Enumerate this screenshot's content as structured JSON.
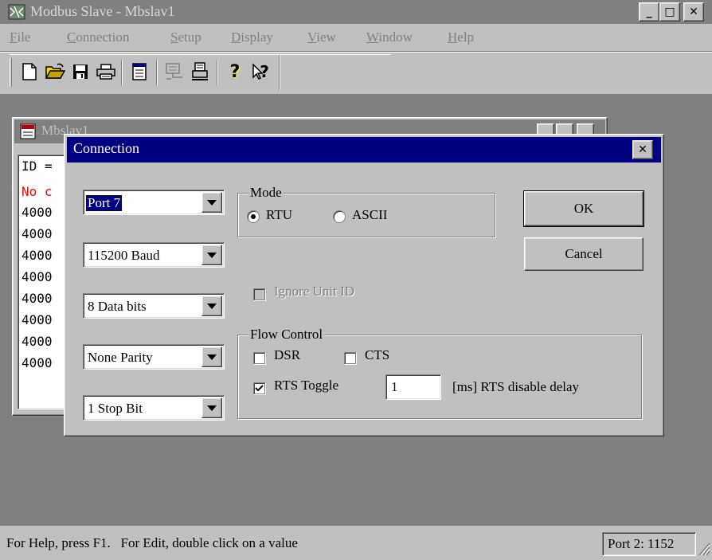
{
  "app": {
    "title": "Modbus Slave - Mbslav1",
    "controls": {
      "minimize": "_",
      "maximize": "□",
      "close": "✕"
    }
  },
  "menu": {
    "items": [
      {
        "label": "File",
        "accel": "F",
        "rest": "ile"
      },
      {
        "label": "Connection",
        "accel": "C",
        "rest": "onnection"
      },
      {
        "label": "Setup",
        "accel": "S",
        "rest": "etup"
      },
      {
        "label": "Display",
        "accel": "D",
        "rest": "isplay"
      },
      {
        "label": "View",
        "accel": "V",
        "rest": "iew"
      },
      {
        "label": "Window",
        "accel": "W",
        "rest": "indow"
      },
      {
        "label": "Help",
        "accel": "H",
        "rest": "elp"
      }
    ]
  },
  "toolbar": {
    "icons": [
      "new-icon",
      "open-icon",
      "save-icon",
      "print-icon",
      "window-icon",
      "connect-icon",
      "printer-setup-icon",
      "help-icon",
      "context-help-icon"
    ],
    "help_glyph": "?",
    "context_help_glyph": "?"
  },
  "child_window": {
    "title": "Mbslav1",
    "rows": [
      "ID =",
      "No c",
      "4000",
      "4000",
      "4000",
      "4000",
      "4000",
      "4000",
      "4000",
      "4000"
    ],
    "row_colors": [
      "#000000",
      "#ff0000",
      "#000000",
      "#000000",
      "#000000",
      "#000000",
      "#000000",
      "#000000",
      "#000000",
      "#000000"
    ]
  },
  "dialog": {
    "title": "Connection",
    "close_glyph": "✕",
    "port": "Port 7",
    "baud": "115200 Baud",
    "data_bits": "8 Data bits",
    "parity": "None Parity",
    "stop_bits": "1 Stop Bit",
    "mode": {
      "label": "Mode",
      "options": [
        "RTU",
        "ASCII"
      ],
      "selected": "RTU"
    },
    "ignore_unit_id": {
      "label": "Ignore Unit ID",
      "checked": false,
      "enabled": false
    },
    "flow_control": {
      "label": "Flow Control",
      "dsr": {
        "label": "DSR",
        "checked": false
      },
      "cts": {
        "label": "CTS",
        "checked": false
      },
      "rts_toggle": {
        "label": "RTS Toggle",
        "checked": true
      },
      "rts_delay_value": "1",
      "rts_delay_label": "[ms] RTS disable delay"
    },
    "ok_label": "OK",
    "cancel_label": "Cancel"
  },
  "statusbar": {
    "message": "For Help, press F1.   For Edit, double click on a value",
    "port_info": "Port 2: 1152"
  },
  "colors": {
    "active_title": "#000080",
    "inactive_title": "#808080",
    "face": "#c0c0c0"
  }
}
